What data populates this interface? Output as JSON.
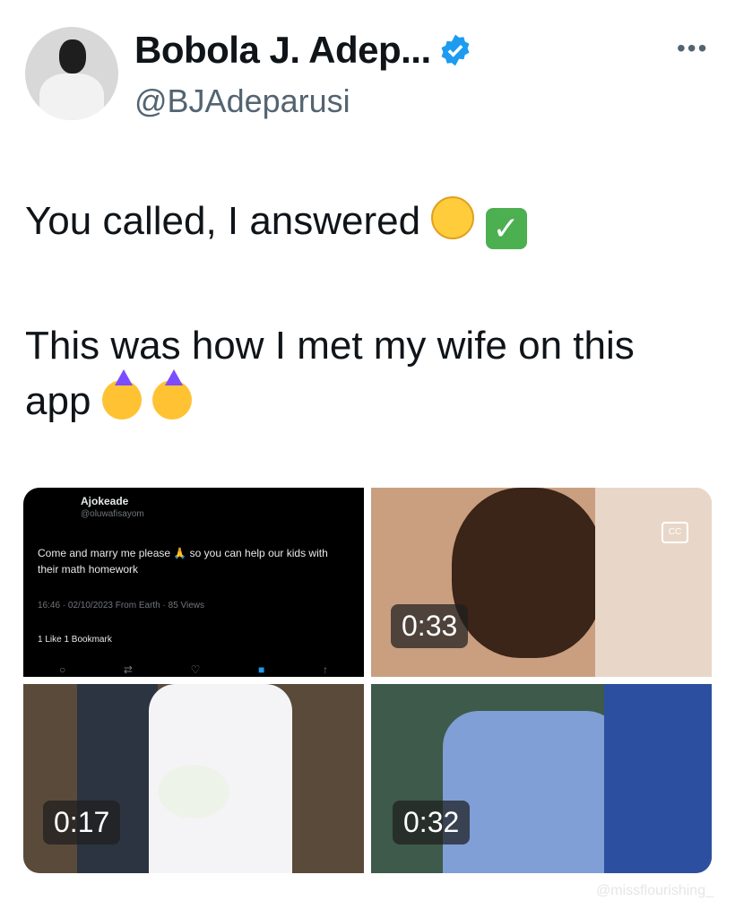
{
  "author": {
    "display_name": "Bobola J. Adep...",
    "handle": "@BJAdeparusi"
  },
  "menu": {
    "more_label": "•••"
  },
  "tweet": {
    "line1": "You called, I answered",
    "line2": "This was how I met my wife on this app"
  },
  "media": {
    "embedded_tweet": {
      "name": "Ajokeade",
      "handle": "@oluwafisayom",
      "text": "Come and marry me please 🙏 so you can help our kids with their math homework",
      "meta": "16:46 · 02/10/2023 From Earth · 85 Views",
      "stats": "1 Like  1 Bookmark"
    },
    "durations": [
      "0:33",
      "0:17",
      "0:32"
    ]
  },
  "watermark": "@missflourishing_",
  "icons": [
    "avatar",
    "verified-badge-icon",
    "more-icon",
    "grinning-emoji-icon",
    "check-emoji-icon",
    "party-emoji-icon",
    "closed-captions-icon"
  ],
  "colors": {
    "verified_blue": "#1d9bf0",
    "handle_gray": "#536471"
  }
}
